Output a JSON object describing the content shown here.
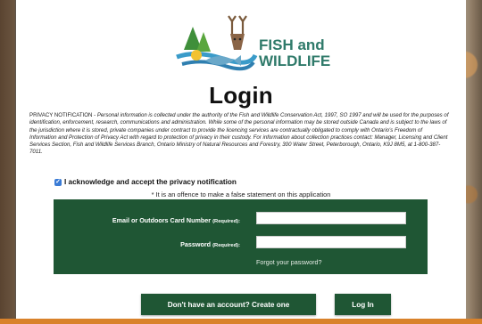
{
  "brand": {
    "logo_line1": "FISH and",
    "logo_line2": "WILDLIFE",
    "primary_color": "#1f5634",
    "accent_color": "#d9822b"
  },
  "page": {
    "title": "Login"
  },
  "privacy": {
    "lead": "PRIVACY NOTIFICATION - ",
    "body": "Personal information is collected under the authority of the Fish and Wildlife Conservation Act, 1997, SO 1997 and will be used for the purposes of identification, enforcement, research, communications and administration. While some of the personal information may be stored outside Canada and is subject to the laws of the jurisdiction where it is stored, private companies under contract to provide the licencing services are contractually obligated to comply with Ontario's Freedom of Information and Protection of Privacy Act with regard to protection of privacy in their custody. For information about collection practices contact: Manager, Licensing and Client Services Section, Fish and Wildlife Services Branch, Ontario Ministry of Natural Resources and Forestry, 300 Water Street, Peterborough, Ontario, K9J 8M5, at 1-800-387-7011."
  },
  "acknowledge": {
    "label": "I acknowledge and accept the privacy notification",
    "checked": true
  },
  "offence_note": "* It is an offence to make a false statement on this application",
  "form": {
    "email_label": "Email or Outdoors Card Number",
    "email_required": "(Required):",
    "email_value": "",
    "password_label": "Password",
    "password_required": "(Required):",
    "password_value": "",
    "forgot_link": "Forgot your password?"
  },
  "buttons": {
    "create_account": "Don't have an account?  Create one",
    "login": "Log In"
  }
}
